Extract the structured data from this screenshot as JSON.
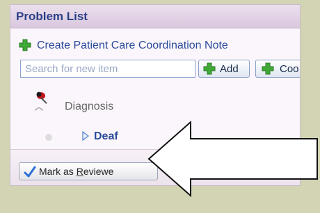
{
  "panel": {
    "title": "Problem List",
    "create_note": "Create Patient Care Coordination Note",
    "search": {
      "placeholder": "Search for new item",
      "value": ""
    },
    "add_label": "Add",
    "code_label": "Coo"
  },
  "problems": {
    "group": "Diagnosis",
    "items": [
      {
        "label": "Deaf"
      }
    ]
  },
  "review": {
    "label_before": "Mark as ",
    "label_accel": "R",
    "label_after": "eviewe"
  },
  "colors": {
    "background": "#d2d4b4",
    "panel": "#fbf6fb",
    "header": "#d9c7de",
    "title": "#2a3f86",
    "plus": "#3fa836",
    "check": "#2e6fd6"
  },
  "icons": [
    "plus-icon",
    "pin-icon",
    "expand-triangle-icon",
    "check-icon",
    "left-arrow-callout"
  ]
}
